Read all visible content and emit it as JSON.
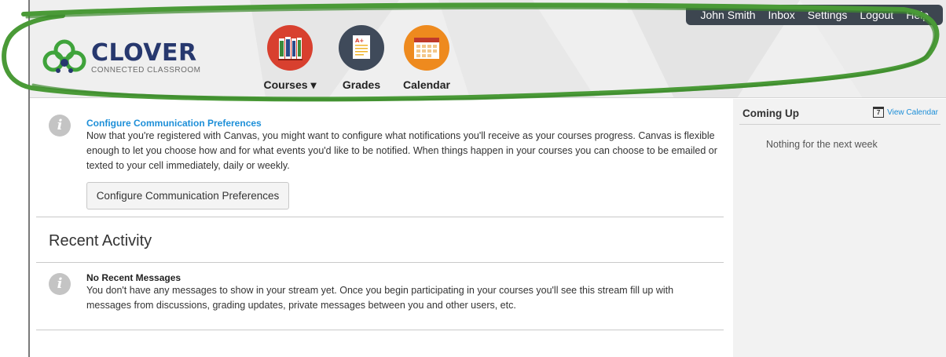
{
  "topnav": {
    "user": "John Smith",
    "inbox": "Inbox",
    "settings": "Settings",
    "logout": "Logout",
    "help": "Help"
  },
  "logo": {
    "title": "CLOVER",
    "subtitle": "CONNECTED CLASSROOM"
  },
  "menu": {
    "courses": "Courses",
    "grades": "Grades",
    "calendar": "Calendar"
  },
  "preferences": {
    "title": "Configure Communication Preferences",
    "text": "Now that you're registered with Canvas, you might want to configure what notifications you'll receive as your courses progress. Canvas is flexible enough to let you choose how and for what events you'd like to be notified. When things happen in your courses you can choose to be emailed or texted to your cell immediately, daily or weekly.",
    "button": "Configure Communication Preferences"
  },
  "recent": {
    "title": "Recent Activity",
    "message_title": "No Recent Messages",
    "message_text": "You don't have any messages to show in your stream yet. Once you begin participating in your courses you'll see this stream fill up with messages from discussions, grading updates, private messages between you and other users, etc."
  },
  "sidebar": {
    "title": "Coming Up",
    "view_calendar": "View Calendar",
    "calendar_day": "7",
    "empty": "Nothing for the next week"
  },
  "colors": {
    "accent": "#1d8fd8",
    "nav": "#3d4650",
    "courses": "#d8402f",
    "grades": "#3f4a5a",
    "calendar": "#ee8a1e",
    "marker": "#4a9a37"
  }
}
